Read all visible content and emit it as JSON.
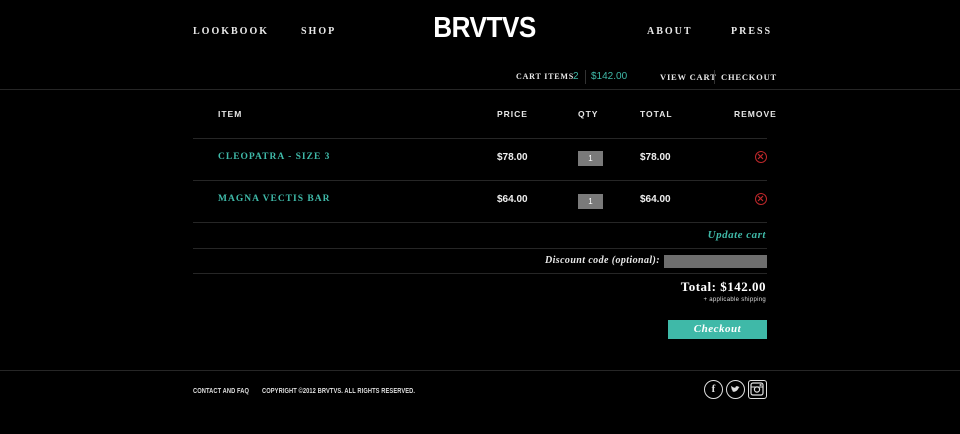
{
  "header": {
    "logo": "BRVTVS",
    "nav_left": [
      "LOOKBOOK",
      "SHOP"
    ],
    "nav_right": [
      "ABOUT",
      "PRESS"
    ]
  },
  "cart_bar": {
    "items_label": "CART ITEMS",
    "items_count": "2",
    "amount": "$142.00",
    "view_cart": "VIEW CART",
    "checkout": "CHECKOUT"
  },
  "table": {
    "headers": {
      "item": "ITEM",
      "price": "PRICE",
      "qty": "QTY",
      "total": "TOTAL",
      "remove": "REMOVE"
    },
    "rows": [
      {
        "name": "CLEOPATRA - SIZE 3",
        "price": "$78.00",
        "qty": "1",
        "total": "$78.00"
      },
      {
        "name": "MAGNA VECTIS BAR",
        "price": "$64.00",
        "qty": "1",
        "total": "$64.00"
      }
    ]
  },
  "cart_actions": {
    "update": "Update cart",
    "discount_label": "Discount code (optional):",
    "discount_value": "",
    "total": "Total: $142.00",
    "shipping_note": "+ applicable shipping",
    "checkout": "Checkout"
  },
  "footer": {
    "contact": "CONTACT AND FAQ",
    "copyright": "COPYRIGHT ©2012 BRVTVS. ALL RIGHTS RESERVED.",
    "social": [
      "facebook-icon",
      "twitter-icon",
      "instagram-icon"
    ]
  },
  "colors": {
    "background": "#000000",
    "accent": "#3fb9a8",
    "remove": "#c0282b"
  }
}
